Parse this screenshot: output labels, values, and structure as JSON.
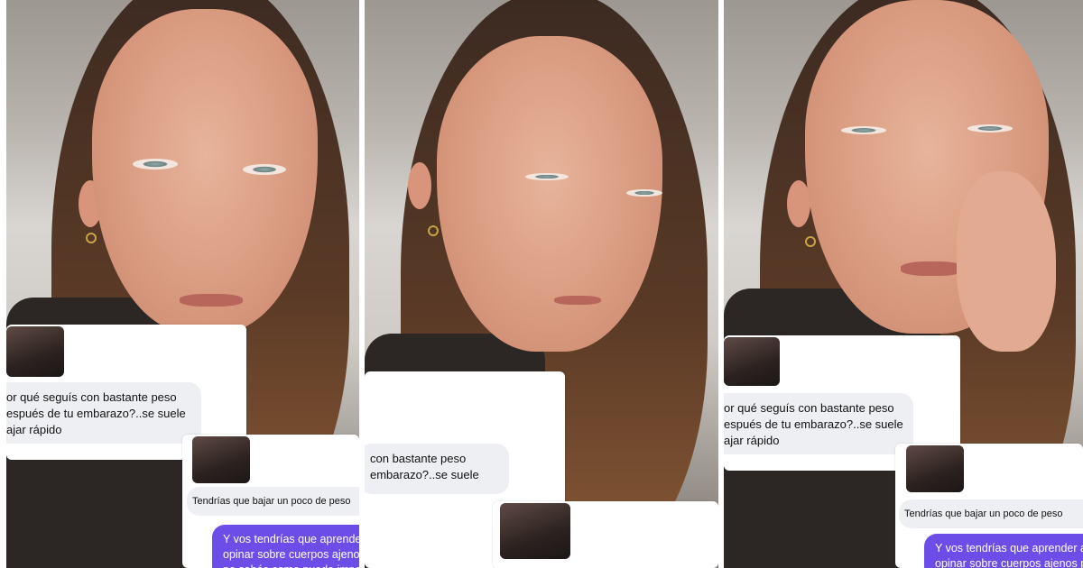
{
  "panels": [
    {
      "question_text": "or qué seguís con bastante peso\nespués de tu embarazo?..se suele\najar rápido",
      "reply_text": "Tendrías que bajar un poco de peso",
      "response_text": "Y vos tendrías que aprender\nopinar sobre cuerpos ajenos\nno sabés como puede impa"
    },
    {
      "question_text": "con bastante peso\nembarazo?..se suele"
    },
    {
      "question_text": "or qué seguís con bastante peso\nespués de tu embarazo?..se suele\najar rápido",
      "reply_text": "Tendrías que bajar un poco de peso",
      "response_text": "Y vos tendrías que aprender a\nopinar sobre cuerpos ajenos p"
    }
  ],
  "colors": {
    "message_purple": "#6d4de8",
    "message_grey": "#eeeff3",
    "divider": "#ffffff"
  }
}
